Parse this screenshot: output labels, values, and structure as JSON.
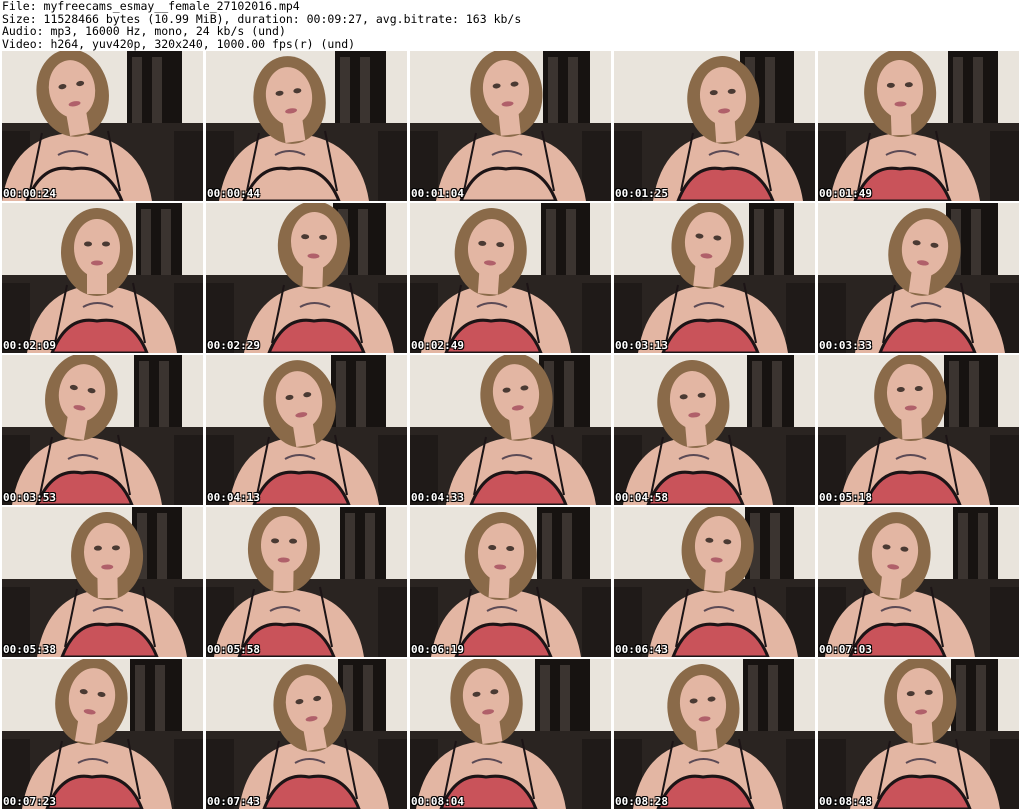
{
  "header": {
    "file_line": "File: myfreecams_esmay__female_27102016.mp4",
    "size_line": "Size: 11528466 bytes (10.99 MiB), duration: 00:09:27, avg.bitrate: 163 kb/s",
    "audio_line": "Audio: mp3, 16000 Hz, mono, 24 kb/s (und)",
    "video_line": "Video: h264, yuv420p, 320x240, 1000.00 fps(r) (und)"
  },
  "colors": {
    "wall": "#e9e4dc",
    "sofa": "#2a2421",
    "frame": "#171311",
    "skin": "#e3b6a3",
    "hair": "#8a6a49",
    "top": "#c9535a",
    "lace": "#1c1416"
  },
  "thumbnails": [
    {
      "timestamp": "00:00:24"
    },
    {
      "timestamp": "00:00:44"
    },
    {
      "timestamp": "00:01:04"
    },
    {
      "timestamp": "00:01:25"
    },
    {
      "timestamp": "00:01:49"
    },
    {
      "timestamp": "00:02:09"
    },
    {
      "timestamp": "00:02:29"
    },
    {
      "timestamp": "00:02:49"
    },
    {
      "timestamp": "00:03:13"
    },
    {
      "timestamp": "00:03:33"
    },
    {
      "timestamp": "00:03:53"
    },
    {
      "timestamp": "00:04:13"
    },
    {
      "timestamp": "00:04:33"
    },
    {
      "timestamp": "00:04:58"
    },
    {
      "timestamp": "00:05:18"
    },
    {
      "timestamp": "00:05:38"
    },
    {
      "timestamp": "00:05:58"
    },
    {
      "timestamp": "00:06:19"
    },
    {
      "timestamp": "00:06:43"
    },
    {
      "timestamp": "00:07:03"
    },
    {
      "timestamp": "00:07:23"
    },
    {
      "timestamp": "00:07:43"
    },
    {
      "timestamp": "00:08:04"
    },
    {
      "timestamp": "00:08:28"
    },
    {
      "timestamp": "00:08:48"
    }
  ]
}
